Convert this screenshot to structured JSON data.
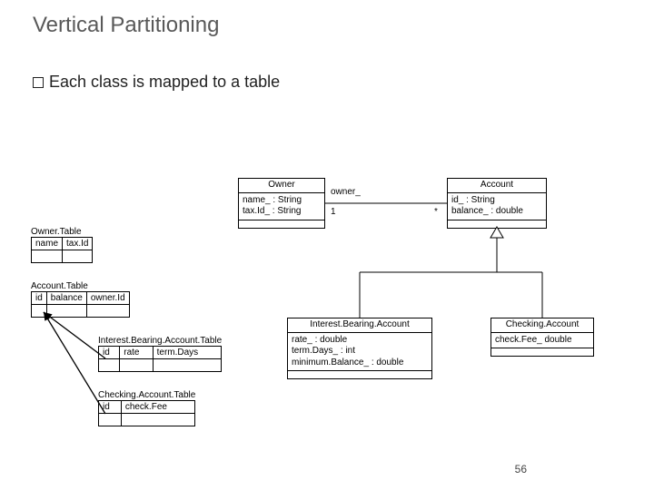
{
  "title": "Vertical Partitioning",
  "bullet": "Each class is mapped to a table",
  "page": "56",
  "tables": {
    "owner": {
      "caption": "Owner.Table",
      "cols": [
        "name",
        "tax.Id"
      ]
    },
    "account": {
      "caption": "Account.Table",
      "cols": [
        "id",
        "balance",
        "owner.Id"
      ]
    },
    "iba": {
      "caption": "Interest.Bearing.Account.Table",
      "cols": [
        "id",
        "rate",
        "term.Days"
      ]
    },
    "checking": {
      "caption": "Checking.Account.Table",
      "cols": [
        "id",
        "check.Fee"
      ]
    }
  },
  "uml": {
    "owner": {
      "name": "Owner",
      "attrs": [
        "name_ : String",
        "tax.Id_ : String"
      ]
    },
    "account": {
      "name": "Account",
      "attrs": [
        "id_ : String",
        "balance_ : double"
      ]
    },
    "iba": {
      "name": "Interest.Bearing.Account",
      "attrs": [
        "rate_ : double",
        "term.Days_ : int",
        "minimum.Balance_ : double"
      ]
    },
    "checking": {
      "name": "Checking.Account",
      "attrs": [
        "check.Fee_ double"
      ]
    }
  },
  "assoc": {
    "role": "owner_",
    "mult_left": "1",
    "mult_right": "*"
  }
}
